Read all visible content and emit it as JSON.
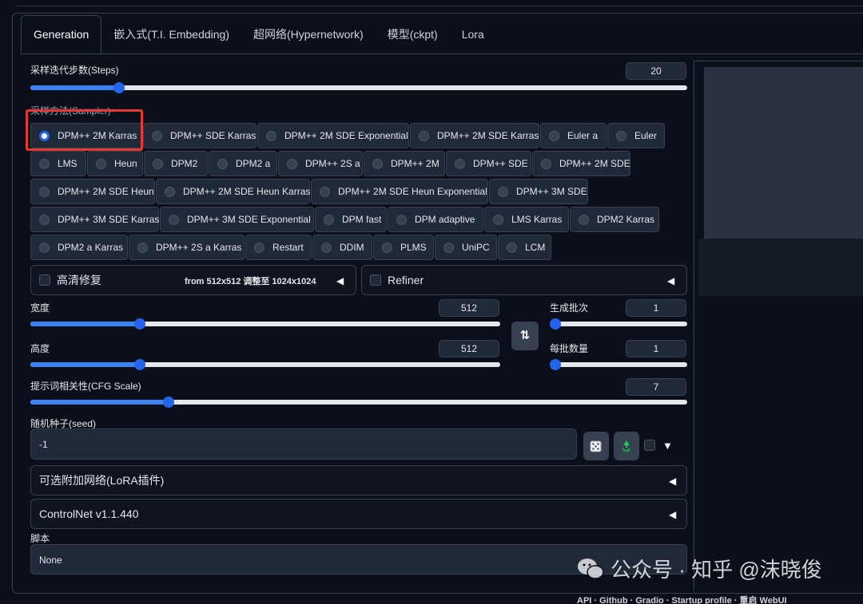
{
  "tabs": [
    "Generation",
    "嵌入式(T.I. Embedding)",
    "超网络(Hypernetwork)",
    "模型(ckpt)",
    "Lora"
  ],
  "steps": {
    "label": "采样迭代步数(Steps)",
    "value": "20",
    "fraction": 0.135
  },
  "sampler": {
    "label": "采样方法(Sampler)",
    "selected": "DPM++ 2M Karras",
    "options_row1": [
      "DPM++ 2M Karras",
      "DPM++ SDE Karras",
      "DPM++ 2M SDE Exponential",
      "DPM++ 2M SDE Karras",
      "Euler a",
      "Euler"
    ],
    "options_row2": [
      "LMS",
      "Heun",
      "DPM2",
      "DPM2 a",
      "DPM++ 2S a",
      "DPM++ 2M",
      "DPM++ SDE",
      "DPM++ 2M SDE"
    ],
    "options_row3": [
      "DPM++ 2M SDE Heun",
      "DPM++ 2M SDE Heun Karras",
      "DPM++ 2M SDE Heun Exponential",
      "DPM++ 3M SDE"
    ],
    "options_row4": [
      "DPM++ 3M SDE Karras",
      "DPM++ 3M SDE Exponential",
      "DPM fast",
      "DPM adaptive",
      "LMS Karras",
      "DPM2 Karras"
    ],
    "options_row5": [
      "DPM2 a Karras",
      "DPM++ 2S a Karras",
      "Restart",
      "DDIM",
      "PLMS",
      "UniPC",
      "LCM"
    ]
  },
  "hires": {
    "label": "高清修复",
    "info": "from 512x512  调整至 1024x1024"
  },
  "refiner": {
    "label": "Refiner"
  },
  "width": {
    "label": "宽度",
    "value": "512",
    "fraction": 0.233
  },
  "height": {
    "label": "高度",
    "value": "512",
    "fraction": 0.233
  },
  "batch_count": {
    "label": "生成批次",
    "value": "1",
    "fraction": 0.0
  },
  "batch_size": {
    "label": "每批数量",
    "value": "1",
    "fraction": 0.0
  },
  "swap_icon": "⇅",
  "cfg": {
    "label": "提示词相关性(CFG Scale)",
    "value": "7",
    "fraction": 0.21
  },
  "seed": {
    "label": "随机种子(seed)",
    "value": "-1"
  },
  "lora_accordion": {
    "label": "可选附加网络(LoRA插件)"
  },
  "controlnet_accordion": {
    "label": "ControlNet v1.1.440"
  },
  "script": {
    "label": "脚本",
    "value": "None"
  },
  "footer": "API  ·  Github  ·  Gradio  ·  Startup profile  ·  重启 WebUI",
  "watermark": "公众号 · 知乎 @沫晓俊",
  "colors": {
    "accent": "#2563eb",
    "highlight_box": "#e53935",
    "background": "#0b0f19"
  }
}
